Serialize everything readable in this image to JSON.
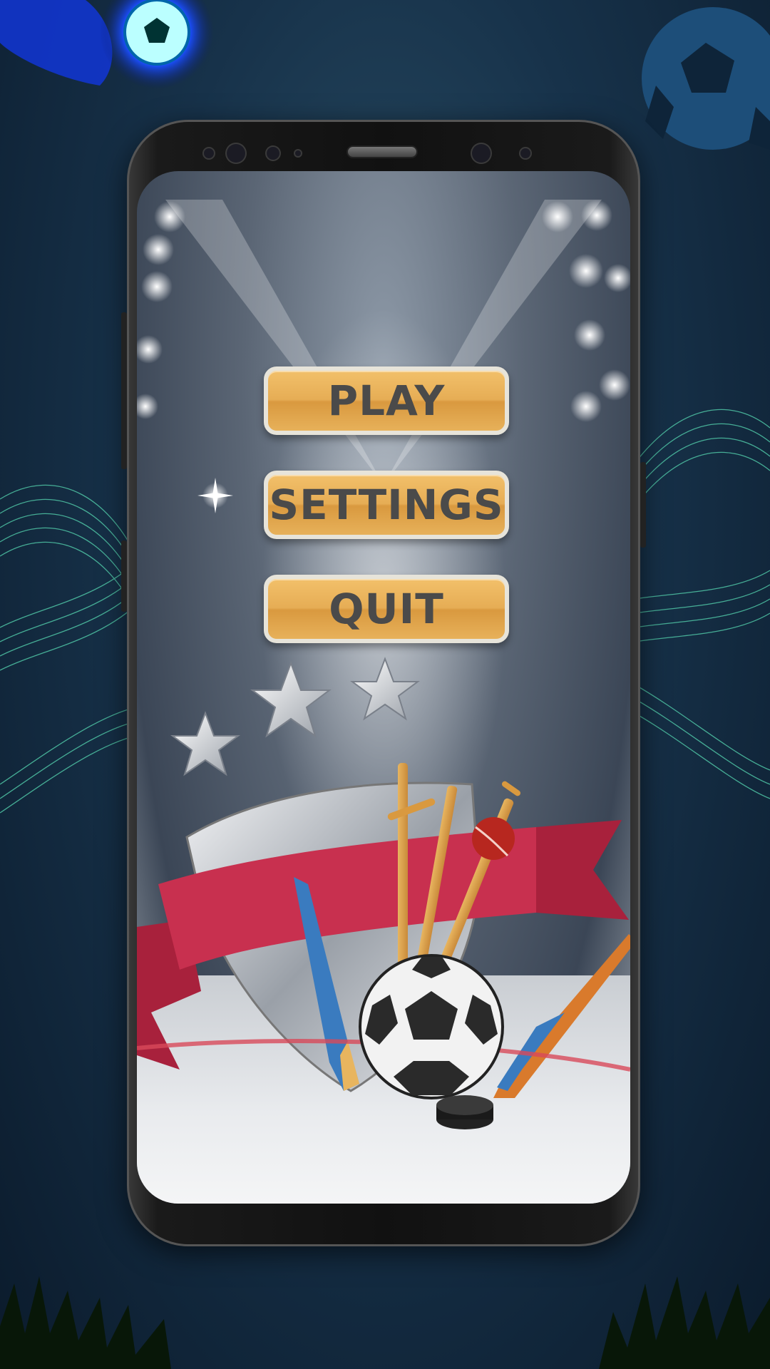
{
  "menu": {
    "play_label": "PLAY",
    "settings_label": "SETTINGS",
    "quit_label": "QUIT"
  },
  "colors": {
    "button_fill": "#e6ad55",
    "button_text": "#4a4a4a",
    "ribbon": "#c8304f",
    "background": "#17324a"
  }
}
